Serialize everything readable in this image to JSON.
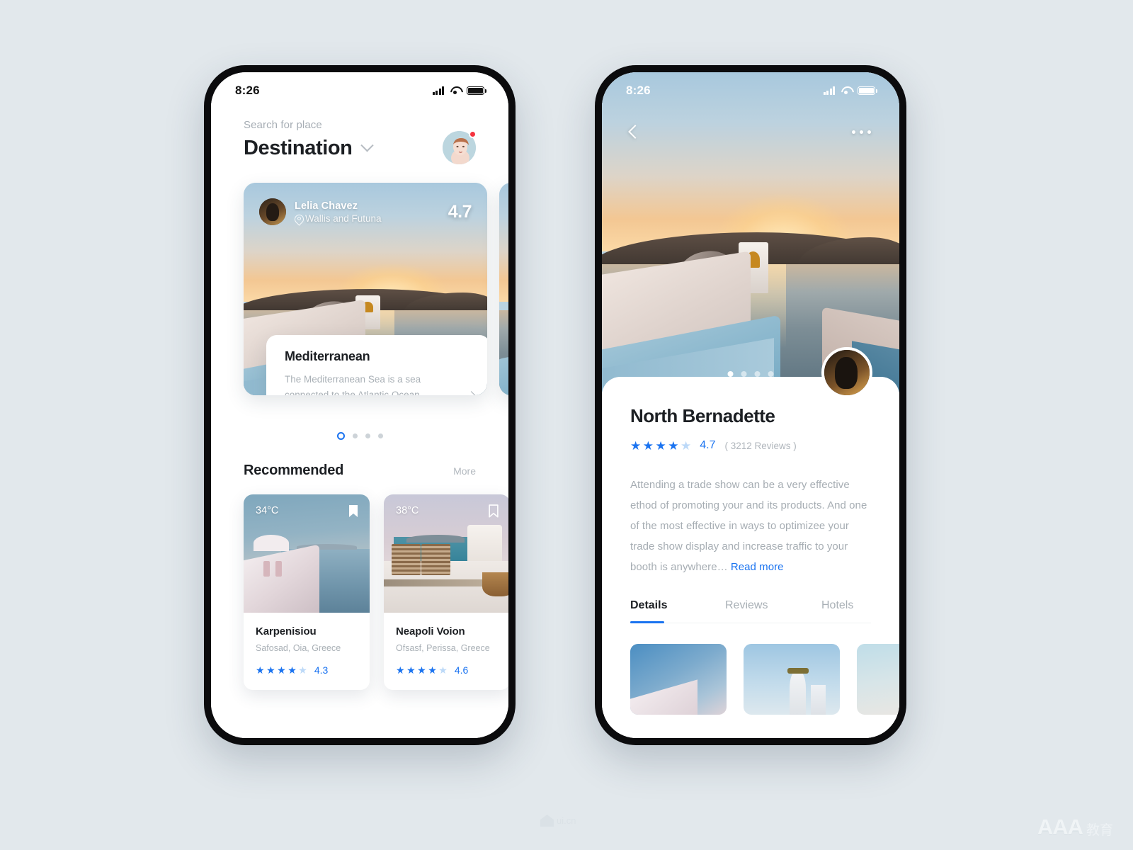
{
  "meta": {
    "background_color": "#e2e8ec",
    "accent_color": "#1a73f0",
    "text_primary": "#1c1f23",
    "text_muted": "#a9b0b6"
  },
  "status_bar": {
    "time": "8:26"
  },
  "home": {
    "search_label": "Search for place",
    "title": "Destination",
    "hero": {
      "host_name": "Lelia Chavez",
      "host_location": "Wallis and Futuna",
      "score": "4.7",
      "info_title": "Mediterranean",
      "info_desc": "The Mediterranean Sea is a sea connected to the Atlantic Ocean…"
    },
    "carousel_dots": 4,
    "carousel_active": 0,
    "recommended": {
      "title": "Recommended",
      "more_label": "More",
      "cards": [
        {
          "temp": "34°C",
          "name": "Karpenisiou",
          "address": "Safosad, Oia, Greece",
          "rating": "4.3",
          "stars_filled": 4,
          "bookmarked": true
        },
        {
          "temp": "38°C",
          "name": "Neapoli Voion",
          "address": "Ofsasf, Perissa, Greece",
          "rating": "4.6",
          "stars_filled": 4,
          "bookmarked": false
        }
      ]
    }
  },
  "detail": {
    "title": "North Bernadette",
    "rating": "4.7",
    "stars_filled": 4,
    "reviews": "( 3212 Reviews )",
    "description": "Attending a trade show can be a very effective ethod of promoting your and its products. And one of the most effective in ways to optimizee your trade show display and increase traffic to your booth is anywhere… ",
    "read_more": "Read more",
    "hero_dots": 4,
    "hero_active": 0,
    "tabs": [
      {
        "label": "Details",
        "active": true
      },
      {
        "label": "Reviews",
        "active": false
      },
      {
        "label": "Hotels",
        "active": false
      }
    ]
  },
  "watermarks": {
    "center": "ui.cn",
    "right_main": "AAA",
    "right_sub": "教育"
  }
}
